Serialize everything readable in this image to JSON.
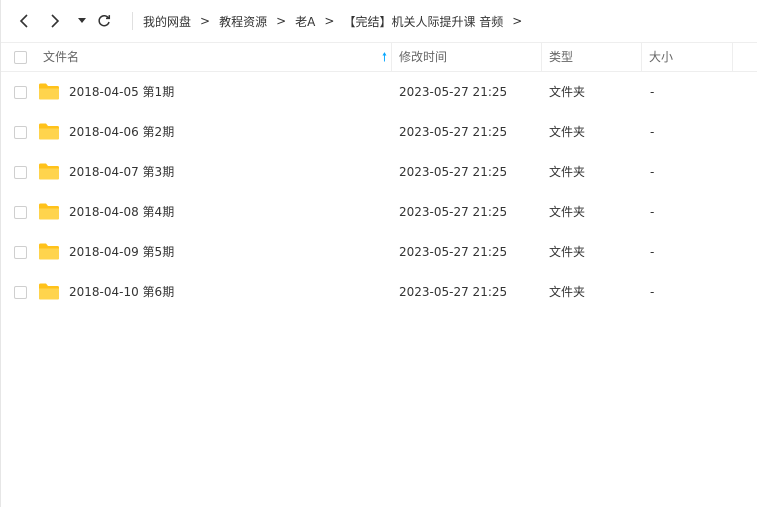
{
  "navbar": {
    "breadcrumb": [
      "我的网盘",
      "教程资源",
      "老A",
      "【完结】机关人际提升课 音频"
    ],
    "separator": ">"
  },
  "header": {
    "name": "文件名",
    "modified": "修改时间",
    "type": "类型",
    "size": "大小"
  },
  "colors": {
    "accent": "#06a7ff",
    "folder": "#ffd44d",
    "folder_tab": "#ffc21a"
  },
  "files": [
    {
      "name": "2018-04-05 第1期",
      "modified": "2023-05-27 21:25",
      "type": "文件夹",
      "size": "-"
    },
    {
      "name": "2018-04-06 第2期",
      "modified": "2023-05-27 21:25",
      "type": "文件夹",
      "size": "-"
    },
    {
      "name": "2018-04-07 第3期",
      "modified": "2023-05-27 21:25",
      "type": "文件夹",
      "size": "-"
    },
    {
      "name": "2018-04-08 第4期",
      "modified": "2023-05-27 21:25",
      "type": "文件夹",
      "size": "-"
    },
    {
      "name": "2018-04-09 第5期",
      "modified": "2023-05-27 21:25",
      "type": "文件夹",
      "size": "-"
    },
    {
      "name": "2018-04-10 第6期",
      "modified": "2023-05-27 21:25",
      "type": "文件夹",
      "size": "-"
    }
  ]
}
